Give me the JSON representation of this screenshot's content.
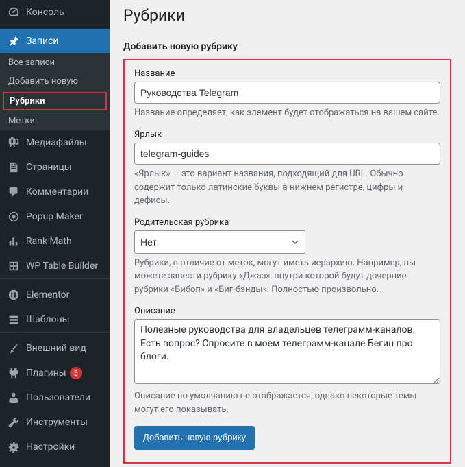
{
  "sidebar": {
    "console": "Консоль",
    "posts": "Записи",
    "submenu": {
      "all_posts": "Все записи",
      "add_new": "Добавить новую",
      "categories": "Рубрики",
      "tags": "Метки"
    },
    "media": "Медиафайлы",
    "pages": "Страницы",
    "comments": "Комментарии",
    "popup_maker": "Popup Maker",
    "rank_math": "Rank Math",
    "wp_table_builder": "WP Table Builder",
    "elementor": "Elementor",
    "templates": "Шаблоны",
    "appearance": "Внешний вид",
    "plugins": "Плагины",
    "plugins_badge": "5",
    "users": "Пользователи",
    "tools": "Инструменты",
    "settings": "Настройки"
  },
  "main": {
    "page_title": "Рубрики",
    "section_title": "Добавить новую рубрику",
    "name": {
      "label": "Название",
      "value": "Руководства Telegram",
      "desc": "Название определяет, как элемент будет отображаться на вашем сайте."
    },
    "slug": {
      "label": "Ярлык",
      "value": "telegram-guides",
      "desc": "«Ярлык» — это вариант названия, подходящий для URL. Обычно содержит только латинские буквы в нижнем регистре, цифры и дефисы."
    },
    "parent": {
      "label": "Родительская рубрика",
      "value": "Нет",
      "desc": "Рубрики, в отличие от меток, могут иметь иерархию. Например, вы можете завести рубрику «Джаз», внутри которой будут дочерние рубрики «Бибоп» и «Биг-бэнды». Полностью произвольно."
    },
    "description": {
      "label": "Описание",
      "value": "Полезные руководства для владельцев телеграмм-каналов. Есть вопрос? Спросите в моем телеграмм-канале Бегин про блоги.",
      "desc": "Описание по умолчанию не отображается, однако некоторые темы могут его показывать."
    },
    "submit": "Добавить новую рубрику"
  }
}
